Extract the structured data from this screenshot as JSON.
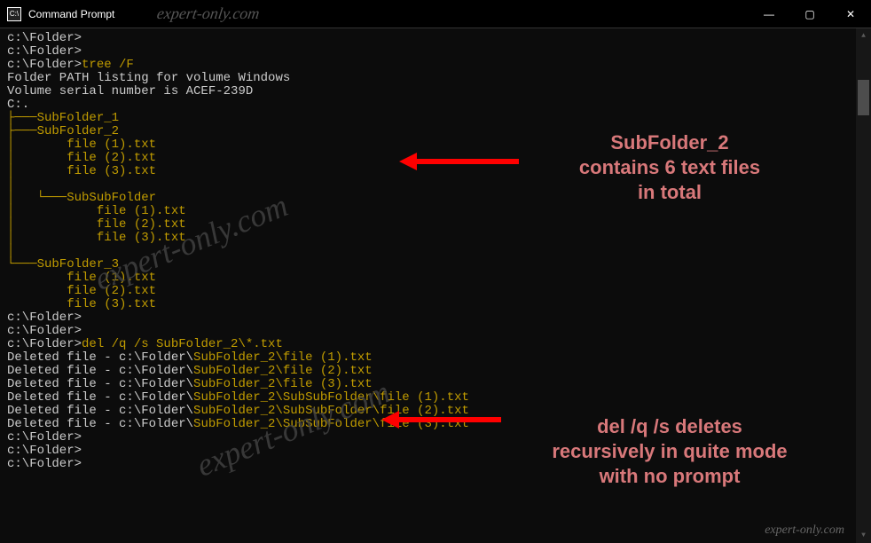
{
  "titlebar": {
    "title": "Command Prompt",
    "watermark": "expert-only.com",
    "min": "—",
    "max": "▢",
    "close": "✕"
  },
  "terminal": {
    "p1": "c:\\Folder>",
    "p2": "c:\\Folder>",
    "p3prompt": "c:\\Folder>",
    "p3cmd": "tree /F",
    "l_volume": "Folder PATH listing for volume Windows",
    "l_serial": "Volume serial number is ACEF-239D",
    "l_root": "C:.",
    "l_sub1": "├───SubFolder_1",
    "l_sub2": "├───SubFolder_2",
    "l_f1": "│       file (1).txt",
    "l_f2": "│       file (2).txt",
    "l_f3": "│       file (3).txt",
    "l_pipe1": "│",
    "l_subsub": "│   └───SubSubFolder",
    "l_sf1": "│           file (1).txt",
    "l_sf2": "│           file (2).txt",
    "l_sf3": "│           file (3).txt",
    "l_pipe2": "│",
    "l_sub3": "└───SubFolder_3",
    "l_s3f1": "        file (1).txt",
    "l_s3f2": "        file (2).txt",
    "l_s3f3": "        file (3).txt",
    "blank": "",
    "p4": "c:\\Folder>",
    "p5": "c:\\Folder>",
    "p6prompt": "c:\\Folder>",
    "p6cmd": "del /q /s SubFolder_2\\*.txt",
    "del_pref": "Deleted file - c:\\Folder\\",
    "del_s1": "SubFolder_2\\file (1).txt",
    "del_s2": "SubFolder_2\\file (2).txt",
    "del_s3": "SubFolder_2\\file (3).txt",
    "del_s4": "SubFolder_2\\SubSubFolder\\file (1).txt",
    "del_s5": "SubFolder_2\\SubSubFolder\\file (2).txt",
    "del_s6": "SubFolder_2\\SubSubFolder\\file (3).txt",
    "p7": "c:\\Folder>",
    "p8": "c:\\Folder>",
    "p9": "c:\\Folder>"
  },
  "annotation1": {
    "l1": "SubFolder_2",
    "l2": "contains 6 text files",
    "l3": "in total"
  },
  "annotation2": {
    "l1": "del /q /s deletes",
    "l2": "recursively in quite mode",
    "l3": "with no prompt"
  },
  "watermarks": {
    "big": "expert-only.com",
    "small": "expert-only.com"
  }
}
